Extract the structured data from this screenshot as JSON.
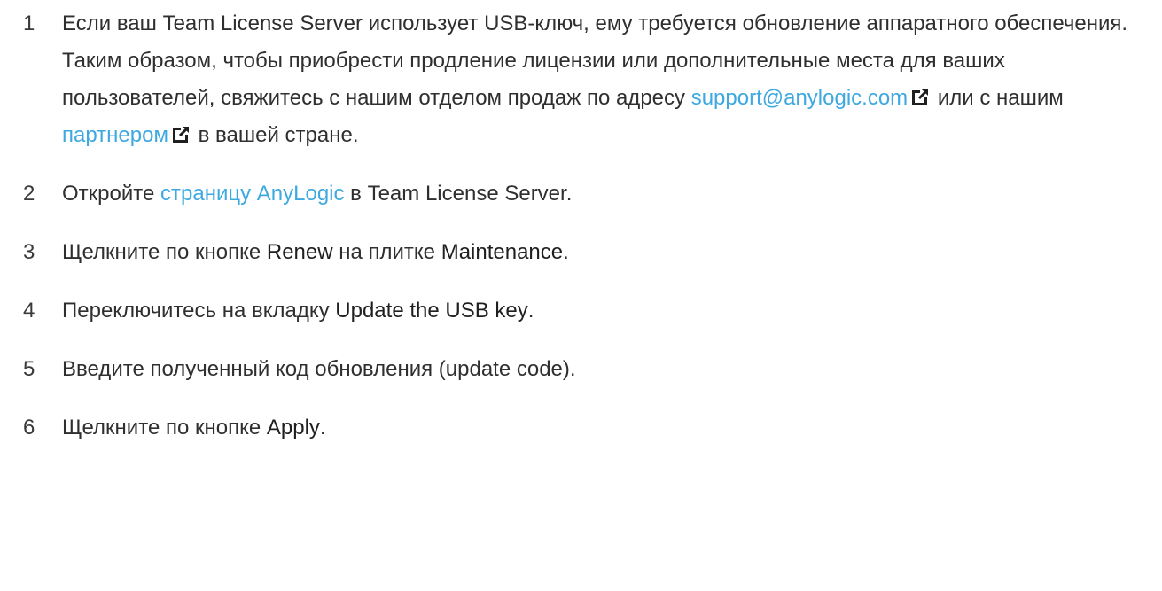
{
  "steps": [
    {
      "number": "1",
      "text_before_email": "Если ваш Team License Server использует USB-ключ, ему требуется обновление аппаратного обеспечения. Таким образом, чтобы приобрести продление лицензии или дополнительные места для ваших пользователей, свяжитесь с нашим отделом продаж по адресу ",
      "email_link": "support@anylogic.com",
      "text_between_links": "или с нашим ",
      "partner_link": "партнером",
      "text_after_partner": "в вашей стране."
    },
    {
      "number": "2",
      "text_before_link": "Откройте ",
      "link": "страницу AnyLogic",
      "text_after_link": " в Team License Server."
    },
    {
      "number": "3",
      "text_before_renew": "Щелкните по кнопке ",
      "renew_term": "Renew",
      "text_middle": " на плитке ",
      "maintenance_term": "Maintenance",
      "text_end": "."
    },
    {
      "number": "4",
      "text_before_term": "Переключитесь на вкладку ",
      "tab_term": "Update the USB key",
      "text_end": "."
    },
    {
      "number": "5",
      "text": "Введите полученный код обновления (update code)."
    },
    {
      "number": "6",
      "text_before_term": "Щелкните по кнопке ",
      "apply_term": "Apply",
      "text_end": "."
    }
  ],
  "icons": {
    "external_link": "external-link-icon"
  },
  "colors": {
    "link": "#3da9e0",
    "text": "#2f2f2f",
    "icon": "#1f1f1f"
  }
}
